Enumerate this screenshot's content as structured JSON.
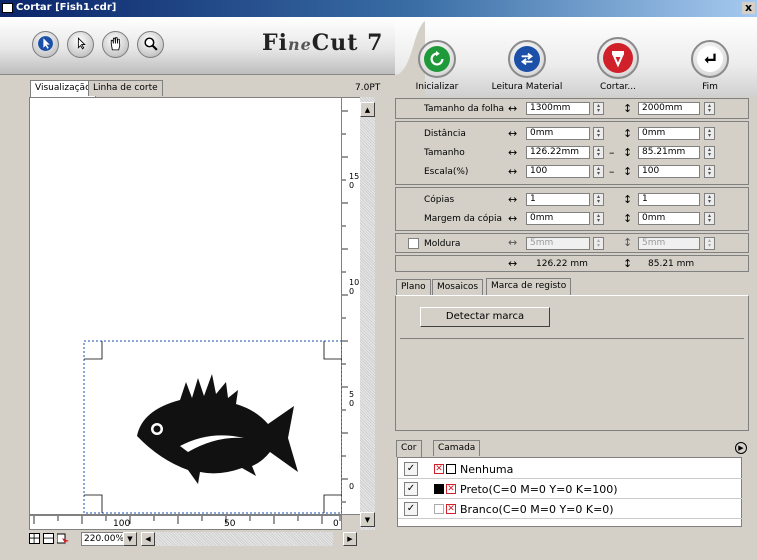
{
  "window": {
    "title": "Cortar [Fish1.cdr]",
    "close_label": "x"
  },
  "logo": {
    "part1": "Fi",
    "part2": "ne",
    "part3": "Cut 7"
  },
  "toolbar": {
    "tools": [
      "pointer-select-icon",
      "pointer-icon",
      "hand-icon",
      "zoom-icon"
    ]
  },
  "actions": {
    "init_label": "Inicializar",
    "read_material_label": "Leitura Material",
    "cut_label": "Cortar...",
    "end_label": "Fim"
  },
  "preview": {
    "tab_preview": "Visualização",
    "tab_cutline": "Linha de corte",
    "pt_label": "7.0PT",
    "vruler_labels": [
      "15",
      "0",
      "10",
      "0",
      "5",
      "0",
      "0"
    ],
    "hruler_labels": [
      "100",
      "50",
      "0"
    ],
    "zoom": "220.00%"
  },
  "sheet": {
    "label": "Tamanho da folha",
    "width": "1300mm",
    "height": "2000mm"
  },
  "position": {
    "distance_label": "Distância",
    "distance_x": "0mm",
    "distance_y": "0mm",
    "size_label": "Tamanho",
    "size_x": "126.22mm",
    "size_y": "85.21mm",
    "scale_label": "Escala(%)",
    "scale_x": "100",
    "scale_y": "100"
  },
  "copies": {
    "copies_label": "Cópias",
    "copies_x": "1",
    "copies_y": "1",
    "margin_label": "Margem da cópia",
    "margin_x": "0mm",
    "margin_y": "0mm"
  },
  "frame": {
    "label": "Moldura",
    "x": "5mm",
    "y": "5mm"
  },
  "summary": {
    "width": "126.22 mm",
    "height": "85.21 mm"
  },
  "lower_tabs": {
    "plan": "Plano",
    "mosaics": "Mosaicos",
    "reg_mark": "Marca de registo"
  },
  "reg_mark": {
    "detect_label": "Detectar marca"
  },
  "color_tabs": {
    "color": "Cor",
    "layer": "Camada"
  },
  "colors": [
    {
      "name": "Nenhuma"
    },
    {
      "name": "Preto(C=0 M=0 Y=0 K=100)"
    },
    {
      "name": "Branco(C=0 M=0 Y=0 K=0)"
    }
  ],
  "accent": {
    "green": "#1f9a3a",
    "blue": "#1b4fa8",
    "red": "#d0202a"
  }
}
